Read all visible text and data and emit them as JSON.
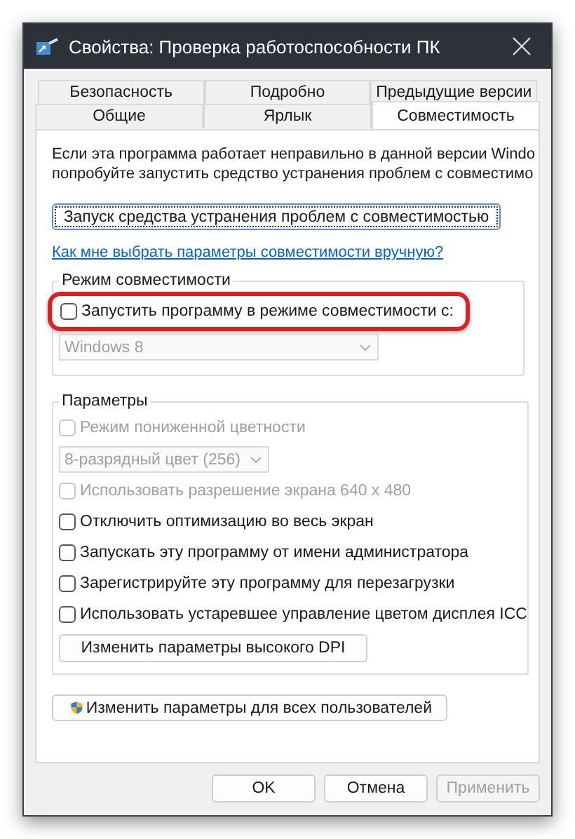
{
  "window": {
    "title": "Свойства: Проверка работоспособности ПК"
  },
  "tab_rows": [
    [
      {
        "label": "Безопасность",
        "selected": false
      },
      {
        "label": "Подробно",
        "selected": false
      },
      {
        "label": "Предыдущие версии",
        "selected": false
      }
    ],
    [
      {
        "label": "Общие",
        "selected": false
      },
      {
        "label": "Ярлык",
        "selected": false
      },
      {
        "label": "Совместимость",
        "selected": true
      }
    ]
  ],
  "intro": [
    "Если эта программа работает неправильно в данной версии Windo",
    "попробуйте запустить средство устранения проблем с совместимо"
  ],
  "troubleshoot_button": {
    "label": "Запуск средства устранения проблем с совместимостью",
    "focused": true
  },
  "help_link": "Как мне выбрать параметры совместимости вручную?",
  "compat_group": {
    "title": "Режим совместимости",
    "checkbox": {
      "label": "Запустить программу в режиме совместимости с:",
      "checked": false,
      "highlighted": true
    },
    "dropdown": {
      "value": "Windows 8",
      "disabled": true
    }
  },
  "settings_group": {
    "title": "Параметры",
    "items": [
      {
        "kind": "checkbox",
        "label": "Режим пониженной цветности",
        "checked": false,
        "disabled": true
      },
      {
        "kind": "dropdown",
        "value": "8-разрядный цвет (256)",
        "disabled": true
      },
      {
        "kind": "checkbox",
        "label": "Использовать разрешение экрана 640 x 480",
        "checked": false,
        "disabled": true
      },
      {
        "kind": "checkbox",
        "label": "Отключить оптимизацию во весь экран",
        "checked": false,
        "disabled": false
      },
      {
        "kind": "checkbox",
        "label": "Запускать эту программу от имени администратора",
        "checked": false,
        "disabled": false
      },
      {
        "kind": "checkbox",
        "label": "Зарегистрируйте эту программу для перезагрузки",
        "checked": false,
        "disabled": false
      },
      {
        "kind": "checkbox",
        "label": "Использовать устаревшее управление цветом дисплея ICC",
        "checked": false,
        "disabled": false
      },
      {
        "kind": "button",
        "label": "Изменить параметры высокого DPI"
      }
    ]
  },
  "all_users_button": {
    "label": "Изменить параметры для всех пользователей"
  },
  "buttons": [
    {
      "label": "OK",
      "disabled": false
    },
    {
      "label": "Отмена",
      "disabled": false
    },
    {
      "label": "Применить",
      "disabled": true
    }
  ]
}
